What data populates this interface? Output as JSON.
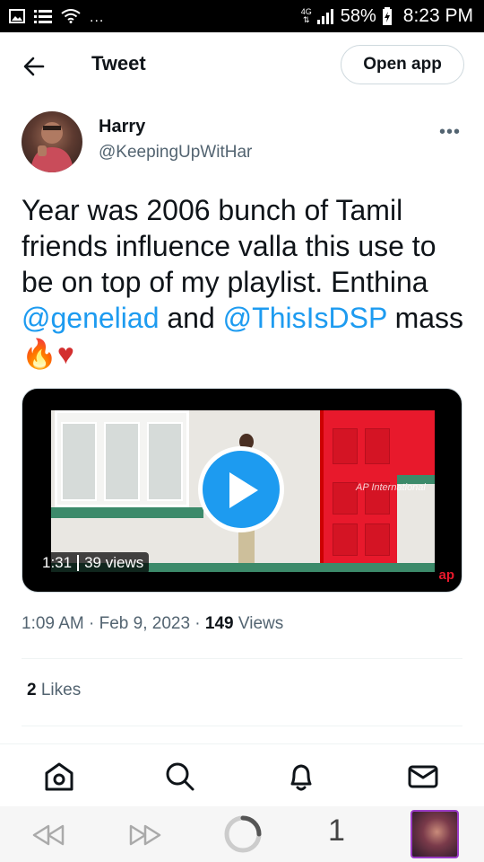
{
  "status_bar": {
    "network": "4G",
    "battery": "58%",
    "time": "8:23 PM",
    "more": "..."
  },
  "header": {
    "title": "Tweet",
    "open_app": "Open app"
  },
  "tweet": {
    "name": "Harry",
    "handle": "@KeepingUpWitHar",
    "more": "•••",
    "text_part1": "Year was 2006 bunch of Tamil friends influence valla this use to be on top of my playlist. Enthina ",
    "mention1": "@geneliad",
    "text_part2": " and ",
    "mention2": "@ThisIsDSP",
    "text_part3": " mass ",
    "emoji": "🔥♥",
    "video": {
      "duration": "1:31",
      "views": "39 views",
      "watermark": "AP International",
      "logo": "ap"
    },
    "time": "1:09 AM",
    "date": "Feb 9, 2023",
    "view_count": "149",
    "views_label": "Views",
    "likes_count": "2",
    "likes_label": "Likes"
  },
  "browser_bar": {
    "tab_count": "1"
  }
}
